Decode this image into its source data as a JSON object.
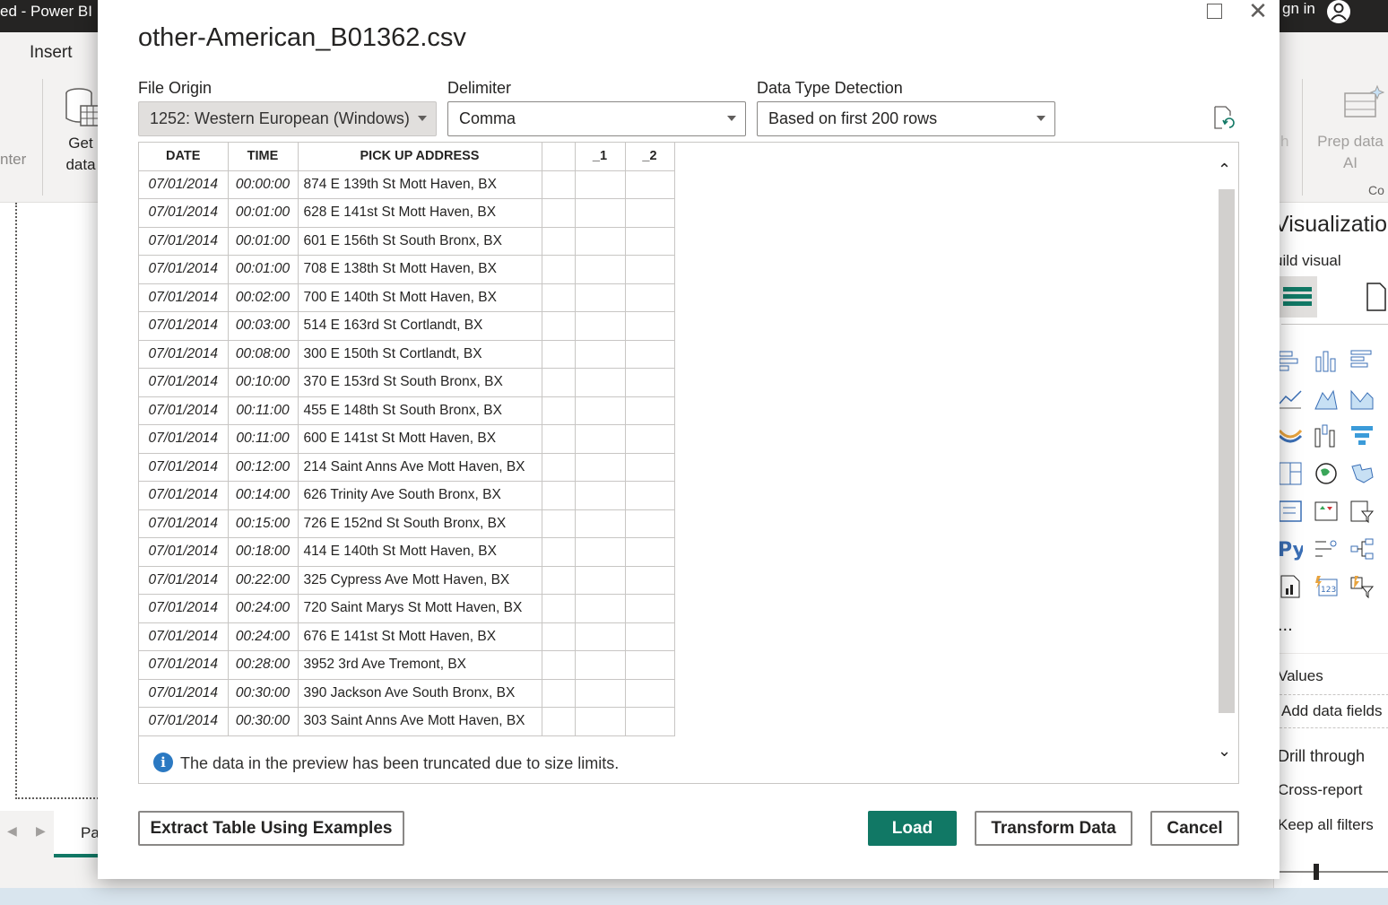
{
  "app": {
    "title": "ed - Power BI",
    "sign_in": "gn in",
    "ribbon": {
      "insert_tab": "Insert",
      "enter_label": "nter",
      "get_data_label": "Get data",
      "h_label": "h",
      "prep_data_label": "Prep data AI",
      "copilot_label": "Co"
    },
    "page_tab": "Pa",
    "viz_pane": {
      "title": "Visualization",
      "build_visual": "uild visual",
      "values": "Values",
      "add_data_fields": "Add data fields",
      "drill_through": "Drill through",
      "cross_report": "Cross-report",
      "keep_all_filters": "Keep all filters",
      "more": "..."
    }
  },
  "dialog": {
    "title": "other-American_B01362.csv",
    "file_origin": {
      "label": "File Origin",
      "value": "1252: Western European (Windows)"
    },
    "delimiter": {
      "label": "Delimiter",
      "value": "Comma"
    },
    "data_type_detection": {
      "label": "Data Type Detection",
      "value": "Based on first 200 rows"
    },
    "table": {
      "columns": [
        "DATE",
        "TIME",
        "PICK UP ADDRESS",
        "",
        "_1",
        "_2"
      ],
      "rows": [
        [
          "07/01/2014",
          "00:00:00",
          "874 E 139th St Mott Haven, BX"
        ],
        [
          "07/01/2014",
          "00:01:00",
          "628 E 141st St Mott Haven, BX"
        ],
        [
          "07/01/2014",
          "00:01:00",
          "601 E 156th St South Bronx, BX"
        ],
        [
          "07/01/2014",
          "00:01:00",
          "708 E 138th St Mott Haven, BX"
        ],
        [
          "07/01/2014",
          "00:02:00",
          "700 E 140th St Mott Haven, BX"
        ],
        [
          "07/01/2014",
          "00:03:00",
          "514 E 163rd St Cortlandt, BX"
        ],
        [
          "07/01/2014",
          "00:08:00",
          "300 E 150th St Cortlandt, BX"
        ],
        [
          "07/01/2014",
          "00:10:00",
          "370 E 153rd St South Bronx, BX"
        ],
        [
          "07/01/2014",
          "00:11:00",
          "455 E 148th St South Bronx, BX"
        ],
        [
          "07/01/2014",
          "00:11:00",
          "600 E 141st St Mott Haven, BX"
        ],
        [
          "07/01/2014",
          "00:12:00",
          "214 Saint Anns Ave Mott Haven, BX"
        ],
        [
          "07/01/2014",
          "00:14:00",
          "626 Trinity Ave South Bronx, BX"
        ],
        [
          "07/01/2014",
          "00:15:00",
          "726 E 152nd St South Bronx, BX"
        ],
        [
          "07/01/2014",
          "00:18:00",
          "414 E 140th St Mott Haven, BX"
        ],
        [
          "07/01/2014",
          "00:22:00",
          "325 Cypress Ave Mott Haven, BX"
        ],
        [
          "07/01/2014",
          "00:24:00",
          "720 Saint Marys St Mott Haven, BX"
        ],
        [
          "07/01/2014",
          "00:24:00",
          "676 E 141st St Mott Haven, BX"
        ],
        [
          "07/01/2014",
          "00:28:00",
          "3952 3rd Ave Tremont, BX"
        ],
        [
          "07/01/2014",
          "00:30:00",
          "390 Jackson Ave South Bronx, BX"
        ],
        [
          "07/01/2014",
          "00:30:00",
          "303 Saint Anns Ave Mott Haven, BX"
        ]
      ]
    },
    "notice": "The data in the preview has been truncated due to size limits.",
    "buttons": {
      "extract": "Extract Table Using Examples",
      "load": "Load",
      "transform": "Transform Data",
      "cancel": "Cancel"
    }
  },
  "colors": {
    "accent": "#117865",
    "titlebar": "#252423",
    "info": "#2b79c2"
  }
}
